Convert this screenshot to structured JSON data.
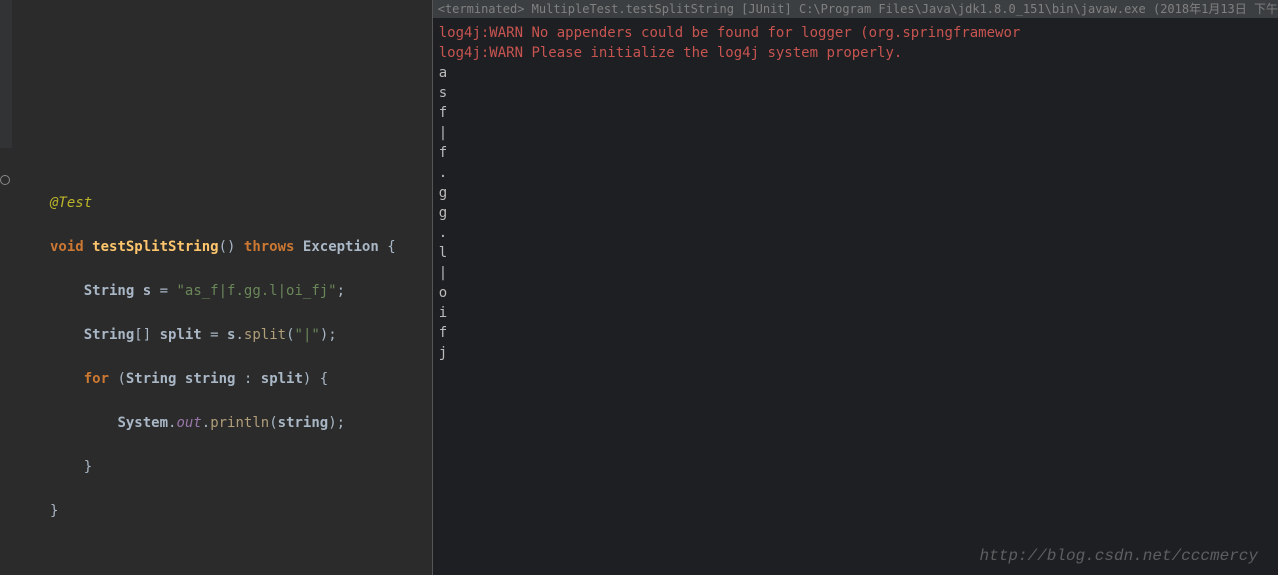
{
  "editor": {
    "annotation": "@Test",
    "kw_void": "void",
    "method_name": "testSplitString",
    "paren_open": "()",
    "kw_throws": "throws",
    "exception": "Exception",
    "brace_open": "{",
    "line2": {
      "type": "String",
      "var": "s",
      "eq": " = ",
      "str": "\"as_f|f.gg.l|oi_fj\"",
      "semi": ";"
    },
    "line3": {
      "type": "String",
      "brackets": "[]",
      "var": "split",
      "eq": " = ",
      "obj": "s",
      "dot": ".",
      "call": "split",
      "args_open": "(",
      "arg": "\"|\"",
      "args_close": ")",
      "semi": ";"
    },
    "line4": {
      "kw_for": "for",
      "paren_open": " (",
      "type": "String",
      "var": "string",
      "colon": " : ",
      "iter": "split",
      "paren_close": ") ",
      "brace": "{"
    },
    "line5": {
      "sys": "System",
      "dot1": ".",
      "out": "out",
      "dot2": ".",
      "call": "println",
      "args_open": "(",
      "arg": "string",
      "args_close": ")",
      "semi": ";"
    },
    "close_inner": "}",
    "close_outer": "}"
  },
  "console": {
    "header": "<terminated> MultipleTest.testSplitString [JUnit] C:\\Program Files\\Java\\jdk1.8.0_151\\bin\\javaw.exe (2018年1月13日 下午",
    "warn1": "log4j:WARN No appenders could be found for logger (org.springframewor",
    "warn2": "log4j:WARN Please initialize the log4j system properly.",
    "output": [
      "a",
      "s",
      " ",
      "f",
      "|",
      "f",
      ".",
      "g",
      "g",
      ".",
      "l",
      "|",
      "o",
      "i",
      " ",
      "f",
      "j"
    ]
  },
  "watermark": "http://blog.csdn.net/cccmercy"
}
